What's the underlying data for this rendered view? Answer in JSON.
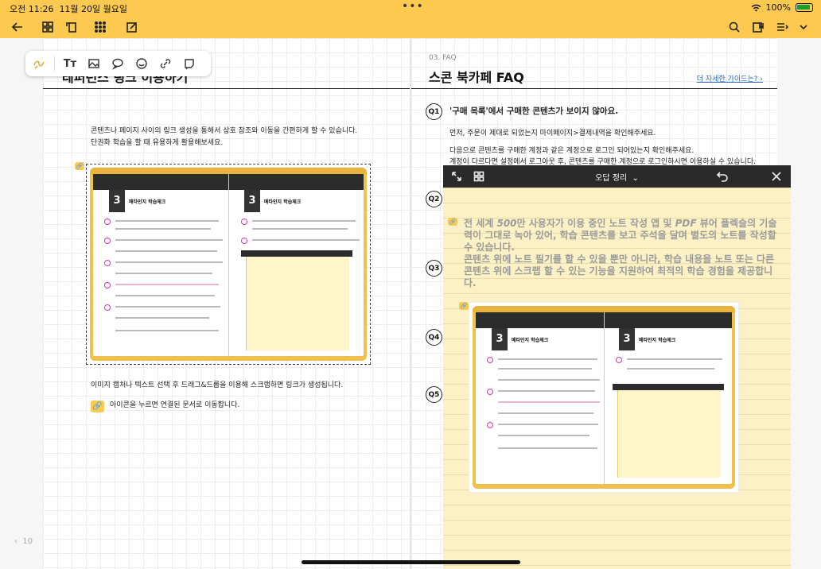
{
  "status": {
    "time": "오전 11:26",
    "date": "11월 20일 월요일",
    "battery": "100%",
    "dots": "•••"
  },
  "left_page": {
    "title": "레퍼런스 링크 이용하기",
    "para1_line1": "콘텐츠나 페이지 사이의 링크 생성을 통해서 상호 참조와 이동을 간편하게 할 수 있습니다.",
    "para1_line2": "단권화 학습을 할 때 유용하게 활용해보세요.",
    "para2": "이미지 캡처나 텍스트 선택 후 드래그&드롭을 이용해 스크랩하면 링크가 생성됩니다.",
    "para3": "아이콘을 누르면 연결된 문서로 이동합니다.",
    "book_chapter": "3",
    "book_chapter_title": "메타인지 학습체크",
    "page_number": "10"
  },
  "right_page": {
    "section_tag": "03. FAQ",
    "title": "스콘 북카페 FAQ",
    "more_link": "더 자세한 가이드는? ",
    "q1_label": "Q1",
    "q1_question": "'구매 목록'에서 구매한 콘텐츠가 보이지 않아요.",
    "q1_answer1": "먼저, 주문이 제대로 되었는지 마이페이지>결제내역을 확인해주세요.",
    "q1_answer2": "다음으로 콘텐츠를 구매한 계정과 같은 계정으로 로그인 되어있는지 확인해주세요.",
    "q1_answer3": "계정이 다르다면 설정에서 로그아웃 후, 콘텐츠를 구매한 계정으로 로그인하시면 이용하실 수 있습니다.",
    "q_labels": [
      "Q2",
      "Q3",
      "Q4",
      "Q5"
    ]
  },
  "panel": {
    "title": "오답 정리",
    "text_line1_a": "전 세계 ",
    "text_line1_b": "500",
    "text_line1_c": "만 사용자가 이용 중인 노트 작성 앱 및 ",
    "text_line1_d": "PDF",
    "text_line1_e": " 뷰어 플렉슬의 기술력이 그대로 녹아 있어, 학습 콘텐츠를 보고 주석을 달며 별도의 노트를 작성할 수 있습니다.",
    "text_line2": "콘텐츠 위에 노트 필기를 할 수 있을 뿐만 아니라, 학습 내용을 노트 또는 다른 콘텐츠 위에 스크랩 할 수 있는 기능을 지원하여 최적의 학습 경험을 제공합니다.",
    "book_chapter": "3",
    "book_chapter_title": "메타인지 학습체크"
  },
  "colors": {
    "accent": "#fdc94f",
    "panel_bg": "#fbf1c4",
    "panel_header": "#2a2a2a",
    "link": "#2d6bc3"
  }
}
